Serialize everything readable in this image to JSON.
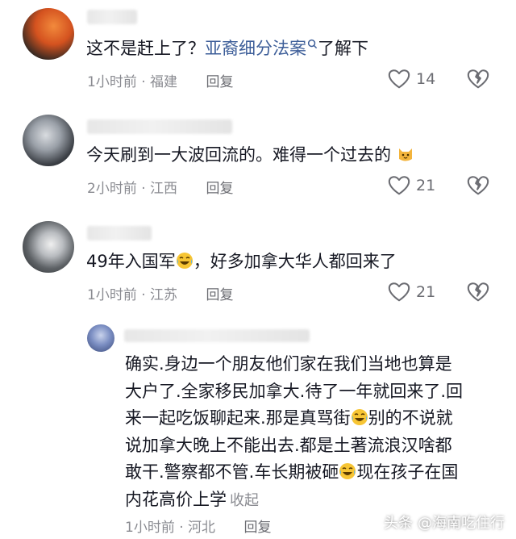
{
  "comments": [
    {
      "text_before": "这不是赶上了？",
      "link_text": "亚裔细分法案",
      "text_after": "了解下",
      "time": "1小时前",
      "location": "福建",
      "reply_label": "回复",
      "likes": "14"
    },
    {
      "text_before": "今天刷到一大波回流的。难得一个过去的",
      "time": "2小时前",
      "location": "江西",
      "reply_label": "回复",
      "likes": "21",
      "emoji": "cat-face-icon"
    },
    {
      "text_before": "49年入国军",
      "text_after": "，好多加拿大华人都回来了",
      "time": "1小时前",
      "location": "江苏",
      "reply_label": "回复",
      "likes": "21",
      "emoji": "laughing-crying-face-icon"
    }
  ],
  "reply": {
    "lines": [
      "确实.身边一个朋友他们家在我们当地也算是",
      "大户了.全家移民加拿大.待了一年就回来了.回",
      "来一起吃饭聊起来.那是真骂街",
      "说加拿大晚上不能出去.都是土著流浪汉啥都",
      "敢干.警察都不管.车长期被砸",
      "内花高价上学"
    ],
    "line3_after": "别的不说就",
    "line5_after": "现在孩子在国",
    "collapse_label": "收起",
    "time": "1小时前",
    "location": "河北",
    "reply_label": "回复"
  },
  "meta_separator": "·",
  "watermark": {
    "prefix": "头条",
    "handle": "@海南吃住行"
  },
  "colors": {
    "link": "#3d5e99",
    "meta": "#8a8b91",
    "text": "#161823"
  }
}
